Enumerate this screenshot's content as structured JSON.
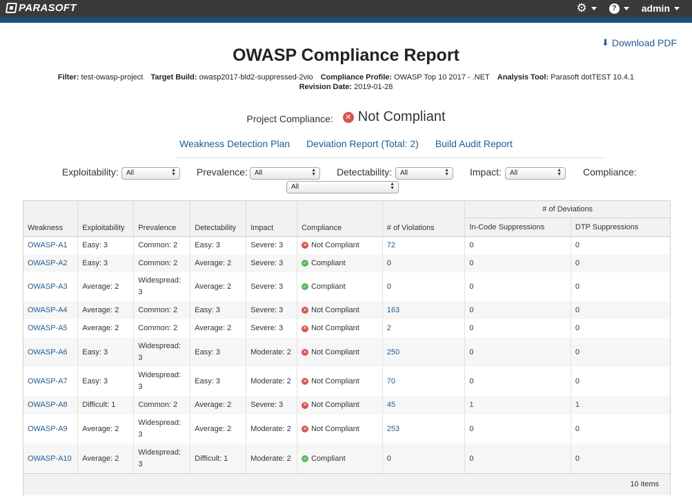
{
  "app": {
    "logo": "PARASOFT",
    "admin_label": "admin"
  },
  "header": {
    "download_label": "Download PDF",
    "title": "OWASP Compliance Report",
    "meta": {
      "filter_label": "Filter:",
      "filter_value": "test-owasp-project",
      "target_label": "Target Build:",
      "target_value": "owasp2017-bld2-suppressed-2vio",
      "profile_label": "Compliance Profile:",
      "profile_value": "OWASP Top 10 2017 - .NET",
      "tool_label": "Analysis Tool:",
      "tool_value": "Parasoft dotTEST 10.4.1",
      "revision_label": "Revision Date:",
      "revision_value": "2019-01-28"
    },
    "project_compliance_label": "Project Compliance:",
    "project_compliance_value": "Not Compliant",
    "links": {
      "plan": "Weakness Detection Plan",
      "deviation": "Deviation Report (Total: 2)",
      "audit": "Build Audit Report"
    }
  },
  "filters": {
    "exploitability_label": "Exploitability:",
    "exploitability_value": "All",
    "prevalence_label": "Prevalence:",
    "prevalence_value": "All",
    "detectability_label": "Detectability:",
    "detectability_value": "All",
    "impact_label": "Impact:",
    "impact_value": "All",
    "compliance_label": "Compliance:",
    "compliance_value": "All"
  },
  "table": {
    "group_header": "# of Deviations",
    "columns": [
      "Weakness",
      "Exploitability",
      "Prevalence",
      "Detectability",
      "Impact",
      "Compliance",
      "# of Violations",
      "In-Code Suppressions",
      "DTP Suppressions"
    ],
    "rows": [
      {
        "weakness": "OWASP-A1",
        "exploitability": "Easy: 3",
        "prevalence": "Common: 2",
        "detectability": "Easy: 3",
        "impact": "Severe: 3",
        "compliance": "Not Compliant",
        "violations": "72",
        "incode": "0",
        "dtp": "0"
      },
      {
        "weakness": "OWASP-A2",
        "exploitability": "Easy: 3",
        "prevalence": "Common: 2",
        "detectability": "Average: 2",
        "impact": "Severe: 3",
        "compliance": "Compliant",
        "violations": "0",
        "incode": "0",
        "dtp": "0"
      },
      {
        "weakness": "OWASP-A3",
        "exploitability": "Average: 2",
        "prevalence": "Widespread: 3",
        "detectability": "Average: 2",
        "impact": "Severe: 3",
        "compliance": "Compliant",
        "violations": "0",
        "incode": "0",
        "dtp": "0"
      },
      {
        "weakness": "OWASP-A4",
        "exploitability": "Average: 2",
        "prevalence": "Common: 2",
        "detectability": "Easy: 3",
        "impact": "Severe: 3",
        "compliance": "Not Compliant",
        "violations": "163",
        "incode": "0",
        "dtp": "0"
      },
      {
        "weakness": "OWASP-A5",
        "exploitability": "Average: 2",
        "prevalence": "Common: 2",
        "detectability": "Average: 2",
        "impact": "Severe: 3",
        "compliance": "Not Compliant",
        "violations": "2",
        "incode": "0",
        "dtp": "0"
      },
      {
        "weakness": "OWASP-A6",
        "exploitability": "Easy: 3",
        "prevalence": "Widespread: 3",
        "detectability": "Easy: 3",
        "impact": "Moderate: 2",
        "compliance": "Not Compliant",
        "violations": "250",
        "incode": "0",
        "dtp": "0"
      },
      {
        "weakness": "OWASP-A7",
        "exploitability": "Easy: 3",
        "prevalence": "Widespread: 3",
        "detectability": "Easy: 3",
        "impact": "Moderate: 2",
        "compliance": "Not Compliant",
        "violations": "70",
        "incode": "0",
        "dtp": "0"
      },
      {
        "weakness": "OWASP-A8",
        "exploitability": "Difficult: 1",
        "prevalence": "Common: 2",
        "detectability": "Average: 2",
        "impact": "Severe: 3",
        "compliance": "Not Compliant",
        "violations": "45",
        "incode": "1",
        "dtp": "1"
      },
      {
        "weakness": "OWASP-A9",
        "exploitability": "Average: 2",
        "prevalence": "Widespread: 3",
        "detectability": "Average: 2",
        "impact": "Moderate: 2",
        "compliance": "Not Compliant",
        "violations": "253",
        "incode": "0",
        "dtp": "0"
      },
      {
        "weakness": "OWASP-A10",
        "exploitability": "Average: 2",
        "prevalence": "Widespread: 3",
        "detectability": "Difficult: 1",
        "impact": "Moderate: 2",
        "compliance": "Compliant",
        "violations": "0",
        "incode": "0",
        "dtp": "0"
      }
    ],
    "footer": "10 items"
  },
  "colors": {
    "topbar": "#3a3a3a",
    "stripe": "#1c4f7c",
    "link": "#1f5a92",
    "not_compliant": "#d9534f",
    "compliant": "#5cb85c"
  }
}
